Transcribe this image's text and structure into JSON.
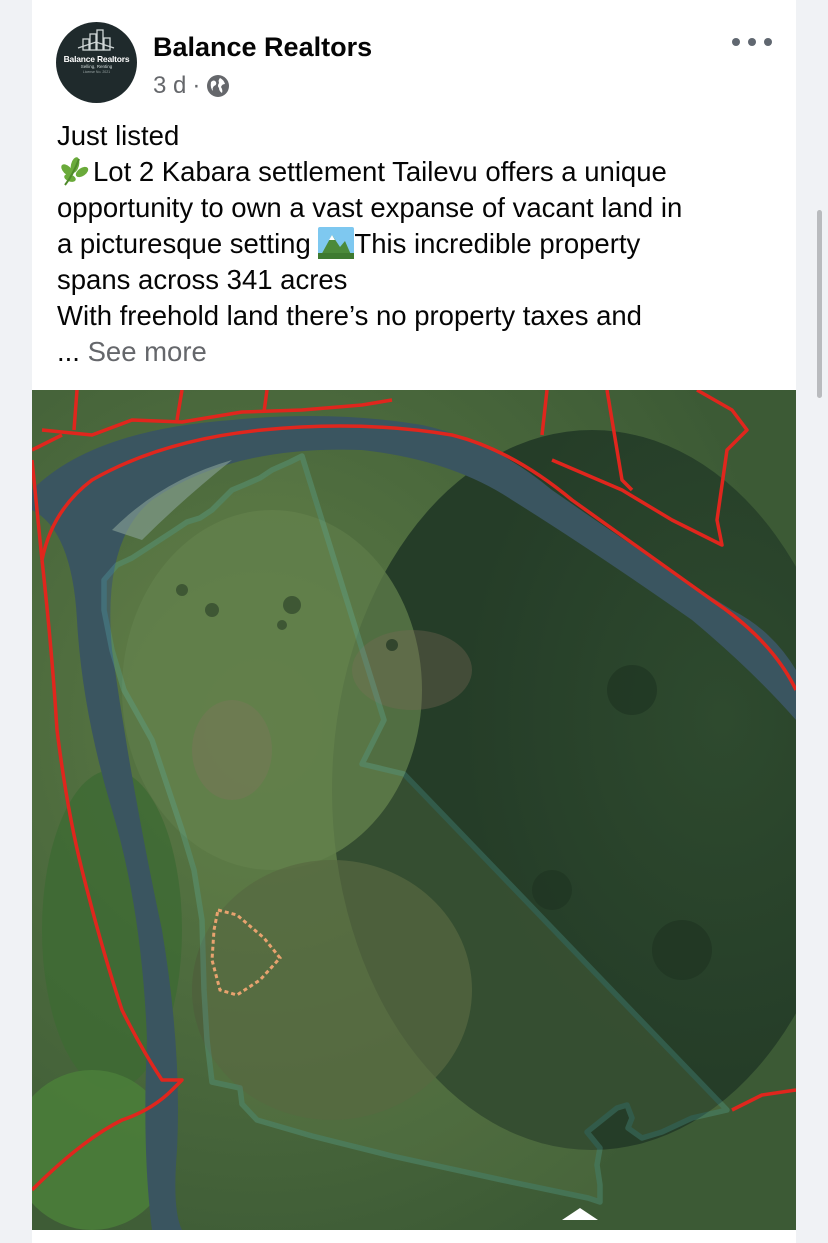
{
  "post": {
    "page_name": "Balance Realtors",
    "avatar": {
      "logo_text": "Balance Realtors",
      "logo_subtext": "Selling, Renting",
      "logo_license": "License No. 2021"
    },
    "time_ago": "3 d",
    "separator": "·",
    "audience_icon": "globe-icon",
    "more_icon": "more-horizontal-icon",
    "text_lines": [
      "Just listed",
      "Lot 2 Kabara settlement Tailevu offers a unique",
      "opportunity to own a vast expanse of vacant land in",
      "a picturesque setting",
      "This incredible property",
      "spans across 341 acres",
      "With freehold land there’s no property taxes and"
    ],
    "ellipsis": "...",
    "see_more": "See more",
    "emojis": [
      "herb-emoji-icon",
      "mountain-landscape-emoji-icon"
    ],
    "photo": {
      "type": "aerial-land-map",
      "boundary_color": "#6ee3e3",
      "other_boundary_color": "#e0261d",
      "river_color": "#3c5560",
      "marker_color": "#e8a36f"
    }
  }
}
